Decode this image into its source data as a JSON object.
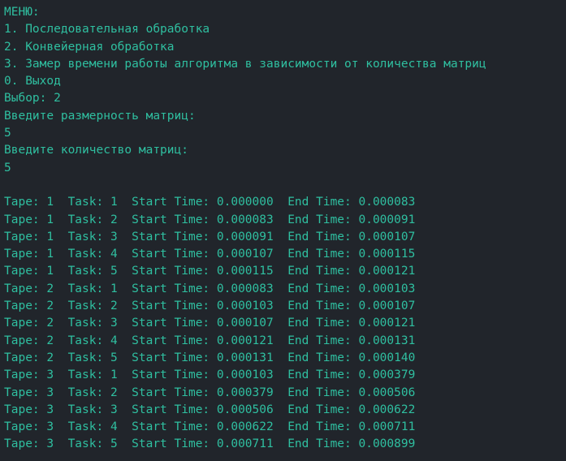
{
  "terminal": {
    "colors": {
      "background": "#21252b",
      "text": "#2fbfa0"
    },
    "lines": [
      "МЕНЮ:",
      "1. Последовательная обработка",
      "2. Конвейерная обработка",
      "3. Замер времени работы алгоритма в зависимости от количества матриц",
      "0. Выход",
      "Выбор: 2",
      "Введите размерность матриц:",
      "5",
      "Введите количество матриц:",
      "5",
      "",
      "Tape: 1  Task: 1  Start Time: 0.000000  End Time: 0.000083",
      "Tape: 1  Task: 2  Start Time: 0.000083  End Time: 0.000091",
      "Tape: 1  Task: 3  Start Time: 0.000091  End Time: 0.000107",
      "Tape: 1  Task: 4  Start Time: 0.000107  End Time: 0.000115",
      "Tape: 1  Task: 5  Start Time: 0.000115  End Time: 0.000121",
      "Tape: 2  Task: 1  Start Time: 0.000083  End Time: 0.000103",
      "Tape: 2  Task: 2  Start Time: 0.000103  End Time: 0.000107",
      "Tape: 2  Task: 3  Start Time: 0.000107  End Time: 0.000121",
      "Tape: 2  Task: 4  Start Time: 0.000121  End Time: 0.000131",
      "Tape: 2  Task: 5  Start Time: 0.000131  End Time: 0.000140",
      "Tape: 3  Task: 1  Start Time: 0.000103  End Time: 0.000379",
      "Tape: 3  Task: 2  Start Time: 0.000379  End Time: 0.000506",
      "Tape: 3  Task: 3  Start Time: 0.000506  End Time: 0.000622",
      "Tape: 3  Task: 4  Start Time: 0.000622  End Time: 0.000711",
      "Tape: 3  Task: 5  Start Time: 0.000711  End Time: 0.000899"
    ]
  }
}
